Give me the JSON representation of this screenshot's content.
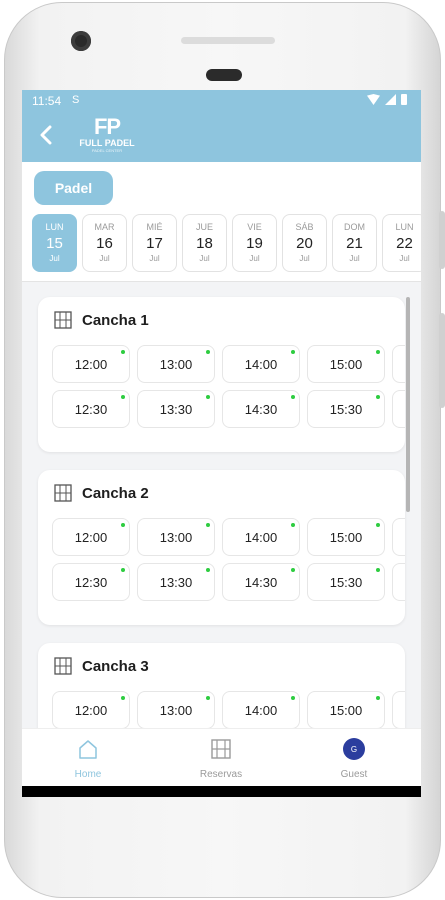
{
  "status_bar": {
    "time": "11:54",
    "sim_icon": "S"
  },
  "header": {
    "back_icon": "chevron-left-icon",
    "logo_mark": "FP",
    "brand": "FULL PADEL",
    "brand_sub": "PADEL CENTER"
  },
  "sport_chip": "Padel",
  "days": [
    {
      "name": "LUN",
      "date": "15",
      "month": "Jul",
      "selected": true
    },
    {
      "name": "MAR",
      "date": "16",
      "month": "Jul"
    },
    {
      "name": "MIÉ",
      "date": "17",
      "month": "Jul"
    },
    {
      "name": "JUE",
      "date": "18",
      "month": "Jul"
    },
    {
      "name": "VIE",
      "date": "19",
      "month": "Jul"
    },
    {
      "name": "SÁB",
      "date": "20",
      "month": "Jul"
    },
    {
      "name": "DOM",
      "date": "21",
      "month": "Jul"
    },
    {
      "name": "LUN",
      "date": "22",
      "month": "Jul"
    }
  ],
  "courts": [
    {
      "title": "Cancha 1",
      "slots": [
        "12:00",
        "13:00",
        "14:00",
        "15:00",
        "12:30",
        "13:30",
        "14:30",
        "15:30"
      ]
    },
    {
      "title": "Cancha 2",
      "slots": [
        "12:00",
        "13:00",
        "14:00",
        "15:00",
        "12:30",
        "13:30",
        "14:30",
        "15:30"
      ]
    },
    {
      "title": "Cancha 3",
      "slots": [
        "12:00",
        "13:00",
        "14:00",
        "15:00"
      ]
    }
  ],
  "nav": {
    "home": "Home",
    "bookings": "Reservas",
    "guest": "Guest",
    "guest_avatar": "G"
  },
  "colors": {
    "accent": "#8ec5de",
    "available_dot": "#2ecc40",
    "avatar": "#2b3d9e"
  }
}
